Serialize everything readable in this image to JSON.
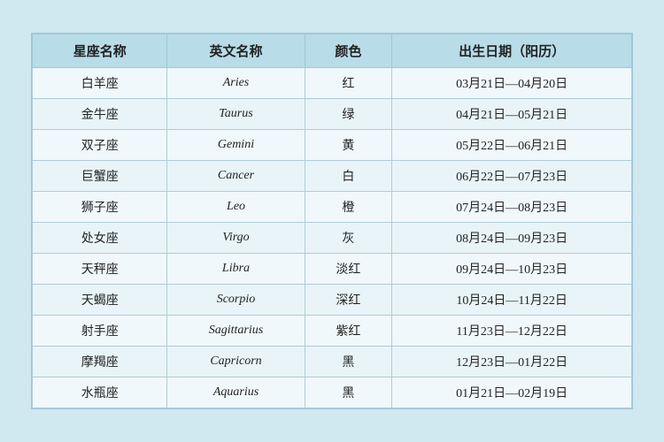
{
  "table": {
    "headers": [
      "星座名称",
      "英文名称",
      "颜色",
      "出生日期（阳历）"
    ],
    "rows": [
      [
        "白羊座",
        "Aries",
        "红",
        "03月21日—04月20日"
      ],
      [
        "金牛座",
        "Taurus",
        "绿",
        "04月21日—05月21日"
      ],
      [
        "双子座",
        "Gemini",
        "黄",
        "05月22日—06月21日"
      ],
      [
        "巨蟹座",
        "Cancer",
        "白",
        "06月22日—07月23日"
      ],
      [
        "狮子座",
        "Leo",
        "橙",
        "07月24日—08月23日"
      ],
      [
        "处女座",
        "Virgo",
        "灰",
        "08月24日—09月23日"
      ],
      [
        "天秤座",
        "Libra",
        "淡红",
        "09月24日—10月23日"
      ],
      [
        "天蝎座",
        "Scorpio",
        "深红",
        "10月24日—11月22日"
      ],
      [
        "射手座",
        "Sagittarius",
        "紫红",
        "11月23日—12月22日"
      ],
      [
        "摩羯座",
        "Capricorn",
        "黑",
        "12月23日—01月22日"
      ],
      [
        "水瓶座",
        "Aquarius",
        "黑",
        "01月21日—02月19日"
      ]
    ]
  }
}
